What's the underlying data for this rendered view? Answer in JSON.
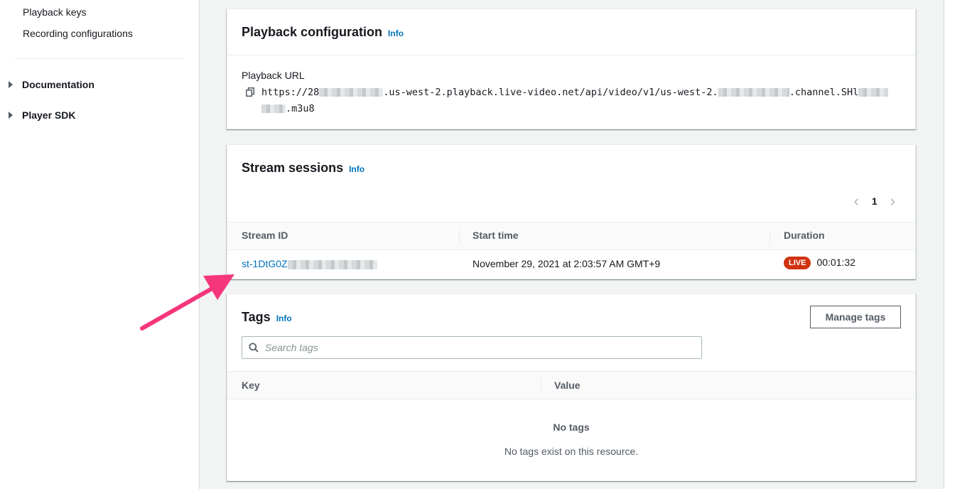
{
  "sidebar": {
    "links": [
      {
        "label": "Playback keys"
      },
      {
        "label": "Recording configurations"
      }
    ],
    "sections": [
      {
        "label": "Documentation"
      },
      {
        "label": "Player SDK"
      }
    ]
  },
  "playback": {
    "title": "Playback configuration",
    "info": "Info",
    "url_label": "Playback URL",
    "url_part1": "https://28",
    "url_part2": ".us-west-2.playback.live-video.net/api/video/v1/us-west-2.",
    "url_part3": ".channel.SHl",
    "url_part4": ".m3u8"
  },
  "sessions": {
    "title": "Stream sessions",
    "info": "Info",
    "page": "1",
    "columns": [
      "Stream ID",
      "Start time",
      "Duration"
    ],
    "rows": [
      {
        "stream_id": "st-1DtG0Z",
        "start_time": "November 29, 2021 at 2:03:57 AM GMT+9",
        "status": "LIVE",
        "duration": "00:01:32"
      }
    ]
  },
  "tags": {
    "title": "Tags",
    "info": "Info",
    "manage_label": "Manage tags",
    "search_placeholder": "Search tags",
    "columns": [
      "Key",
      "Value"
    ],
    "empty_title": "No tags",
    "empty_desc": "No tags exist on this resource."
  },
  "colors": {
    "link": "#0073bb",
    "live_badge": "#d13212",
    "annotation_arrow": "#f5367a"
  }
}
